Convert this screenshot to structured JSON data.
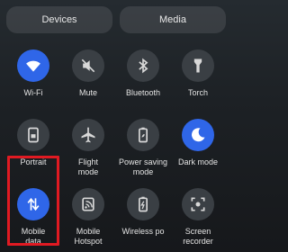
{
  "tabs": {
    "devices": "Devices",
    "media": "Media"
  },
  "tiles": [
    {
      "icon": "wifi-icon",
      "label": "Wi-Fi",
      "active": true
    },
    {
      "icon": "mute-icon",
      "label": "Mute",
      "active": false
    },
    {
      "icon": "bluetooth-icon",
      "label": "Bluetooth",
      "active": false
    },
    {
      "icon": "torch-icon",
      "label": "Torch",
      "active": false
    },
    {
      "icon": "portrait-icon",
      "label": "Portrait",
      "active": false
    },
    {
      "icon": "flight-icon",
      "label_lines": [
        "Flight",
        "mode"
      ],
      "active": false
    },
    {
      "icon": "power-saving-icon",
      "label_lines": [
        "Power saving",
        "mode"
      ],
      "active": false
    },
    {
      "icon": "dark-mode-icon",
      "label": "Dark mode",
      "active": true
    },
    {
      "icon": "mobile-data-icon",
      "label_lines": [
        "Mobile",
        "data"
      ],
      "active": true
    },
    {
      "icon": "hotspot-icon",
      "label_lines": [
        "Mobile",
        "Hotspot"
      ],
      "active": false
    },
    {
      "icon": "wireless-power-icon",
      "label": "Wireless po",
      "active": false
    },
    {
      "icon": "screen-recorder-icon",
      "label_lines": [
        "Screen",
        "recorder"
      ],
      "active": false
    }
  ],
  "colors": {
    "accent": "#2f66e8",
    "highlight": "#e01a22",
    "tile_bg": "#3a3f44"
  }
}
